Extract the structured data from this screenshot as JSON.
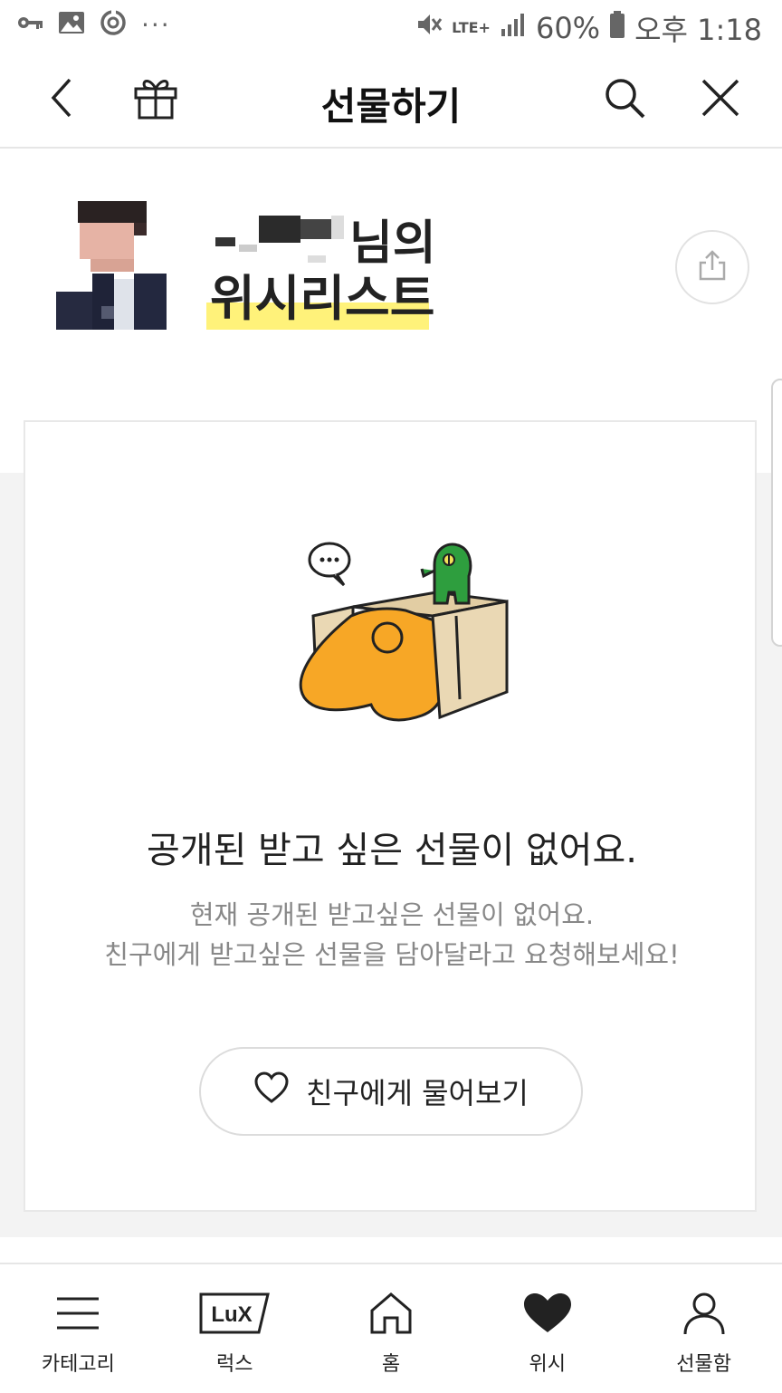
{
  "status_bar": {
    "network": "LTE+",
    "battery": "60%",
    "time": "오후 1:18",
    "left_icons": [
      "key-icon",
      "image-icon",
      "sync-icon",
      "more-dots-icon"
    ],
    "right_icons": [
      "mute-icon",
      "signal-icon",
      "battery-icon"
    ]
  },
  "header": {
    "title": "선물하기",
    "back_icon": "chevron-left-icon",
    "gift_icon": "gift-icon",
    "search_icon": "search-icon",
    "close_icon": "close-icon"
  },
  "profile": {
    "name_suffix": "님의",
    "wishlist_title": "위시리스트",
    "highlight_color": "#fff27a",
    "share_icon": "share-icon"
  },
  "empty_state": {
    "title": "공개된 받고 싶은 선물이 없어요.",
    "desc_line1": "현재 공개된 받고싶은 선물이 없어요.",
    "desc_line2": "친구에게 받고싶은 선물을 담아달라고 요청해보세요!",
    "ask_button": "친구에게 물어보기",
    "ask_icon": "heart-outline-icon"
  },
  "bottom_nav": {
    "items": [
      {
        "label": "카테고리",
        "icon": "menu-icon"
      },
      {
        "label": "럭스",
        "icon": "lux-icon",
        "icon_text": "LuX"
      },
      {
        "label": "홈",
        "icon": "home-icon"
      },
      {
        "label": "위시",
        "icon": "heart-filled-icon"
      },
      {
        "label": "선물함",
        "icon": "person-icon"
      }
    ]
  }
}
